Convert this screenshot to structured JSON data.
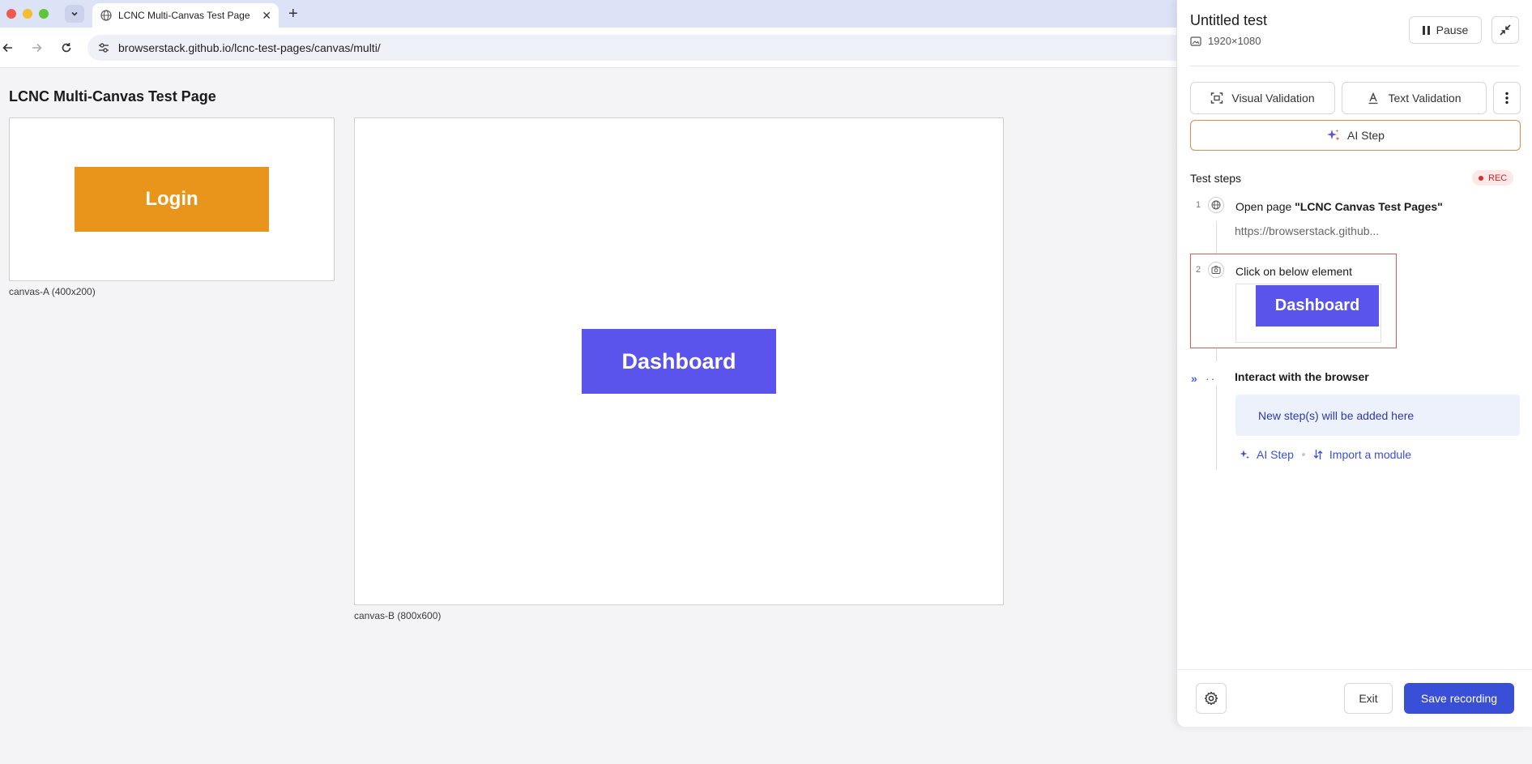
{
  "browser": {
    "tab_title": "LCNC Multi-Canvas Test Page",
    "url": "browserstack.github.io/lcnc-test-pages/canvas/multi/"
  },
  "page": {
    "title": "LCNC Multi-Canvas Test Page",
    "canvas_a": {
      "button_label": "Login",
      "caption": "canvas-A (400x200)"
    },
    "canvas_b": {
      "button_label": "Dashboard",
      "caption": "canvas-B (800x600)"
    }
  },
  "recorder": {
    "title": "Untitled test",
    "resolution": "1920×1080",
    "pause_label": "Pause",
    "visual_validation_label": "Visual Validation",
    "text_validation_label": "Text Validation",
    "ai_step_label": "AI Step",
    "steps_header": "Test steps",
    "rec_badge": "REC",
    "steps": [
      {
        "number": "1",
        "prefix": "Open page ",
        "target": "\"LCNC Canvas Test Pages\"",
        "detail": "https://browserstack.github..."
      },
      {
        "number": "2",
        "text": "Click on below element",
        "thumbnail_label": "Dashboard"
      }
    ],
    "interact_label": "Interact with the browser",
    "new_steps_label": "New step(s) will be added here",
    "link_ai_step": "AI Step",
    "link_import_module": "Import a module",
    "exit_label": "Exit",
    "save_label": "Save recording"
  },
  "colors": {
    "login_button": "#e9951c",
    "dashboard_button": "#5a53ec",
    "primary_action": "#3a4fd8",
    "rec_badge": "#c62828",
    "highlight_border": "#e25b4b"
  }
}
